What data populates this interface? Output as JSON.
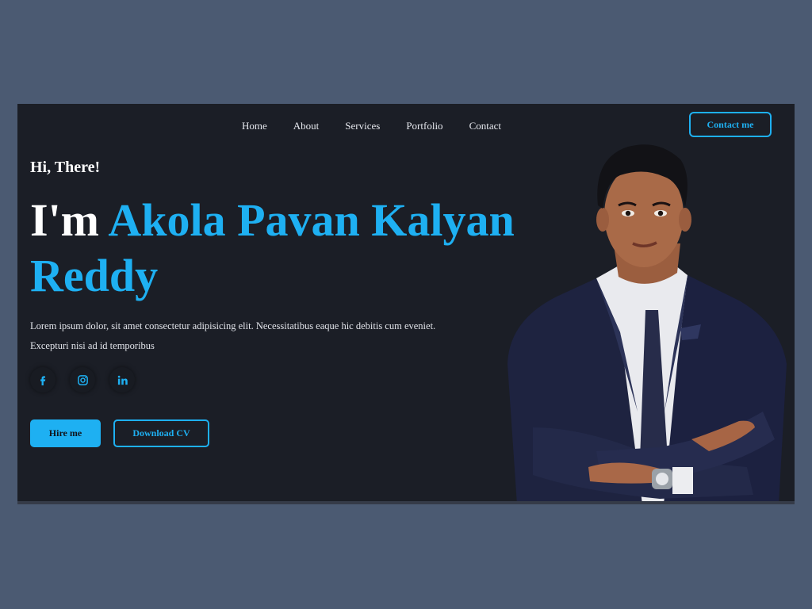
{
  "nav": {
    "items": [
      "Home",
      "About",
      "Services",
      "Portfolio",
      "Contact"
    ],
    "contact_button": "Contact me"
  },
  "hero": {
    "greeting": "Hi, There!",
    "intro": "I'm",
    "name": "Akola Pavan Kalyan Reddy",
    "description": "Lorem ipsum dolor, sit amet consectetur adipisicing elit. Necessitatibus eaque hic debitis cum eveniet. Excepturi nisi ad id temporibus",
    "socials": [
      "facebook-icon",
      "instagram-icon",
      "linkedin-icon"
    ],
    "hire_button": "Hire me",
    "cv_button": "Download CV"
  },
  "colors": {
    "page_bg": "#4b5a72",
    "card_bg": "#1b1e26",
    "accent": "#1eb0f2",
    "text": "#ffffff"
  }
}
